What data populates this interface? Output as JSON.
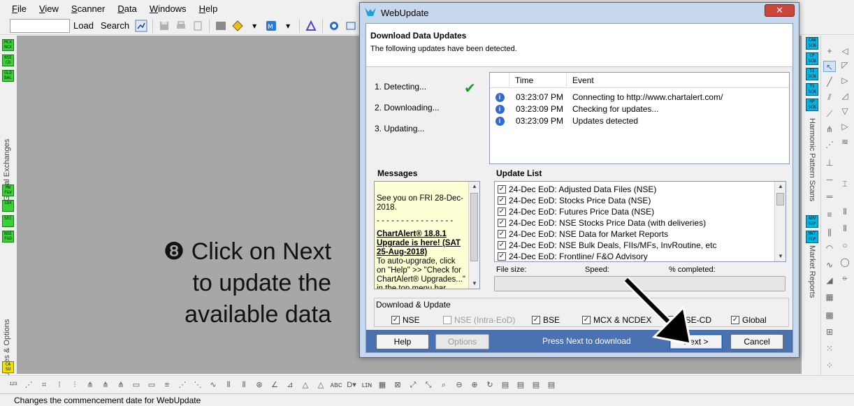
{
  "menubar": {
    "items": [
      "File",
      "View",
      "Scanner",
      "Data",
      "Windows",
      "Help"
    ]
  },
  "toolbar": {
    "search_value": "",
    "load_label": "Load",
    "search_label": "Search"
  },
  "leftbar": {
    "buttons_top": [
      "MCX NCX",
      "NSE CD",
      "GLO BAL"
    ],
    "section1_label": "Global Exchanges",
    "buttons_mid": [
      "MW F&V",
      "IDX",
      "SEC",
      "NSE F&O"
    ],
    "section2_label": "NSE Futures & Options",
    "button_bottom": "CA SU"
  },
  "rightbar": {
    "buttons_top": [
      "CAN SCN",
      "CP SCN",
      "TI SCN",
      "TS SCN",
      "HP SCN"
    ],
    "section1_label": "Harmonic Pattern Scans",
    "buttons_mid": [
      "ADV REP",
      "MKT REP"
    ],
    "section2_label": "Market Reports"
  },
  "annotation": {
    "line1": "❽ Click on Next",
    "line2": "to update the",
    "line3": "available data"
  },
  "dialog": {
    "title": "WebUpdate",
    "close_label": "✕",
    "header_title": "Download Data Updates",
    "header_subtitle": "The following updates have been detected.",
    "steps": [
      "1.  Detecting...",
      "2.  Downloading...",
      "3.  Updating..."
    ],
    "log": {
      "col_time": "Time",
      "col_event": "Event",
      "rows": [
        {
          "time": "03:23:07 PM",
          "event": "Connecting to http://www.chartalert.com/"
        },
        {
          "time": "03:23:09 PM",
          "event": "Checking for updates..."
        },
        {
          "time": "03:23:09 PM",
          "event": "Updates detected"
        }
      ]
    },
    "messages_label": "Messages",
    "messages": {
      "line1": "See you on FRI 28-Dec-2018.",
      "dashes": "- - - - - - - - - - - - - - - -",
      "bold": "ChartAlert® 18.8.1 Upgrade is here! (SAT 25-Aug-2018)",
      "body": "To auto-upgrade, click on \"Help\" >> \"Check for ChartAlert® Upgrades...\" in the top menu bar. Please"
    },
    "update_list_label": "Update List",
    "update_list": [
      "24-Dec EoD: Adjusted Data Files (NSE)",
      "24-Dec EoD: Stocks Price Data (NSE)",
      "24-Dec EoD: Futures Price Data (NSE)",
      "24-Dec EoD: NSE Stocks Price Data (with deliveries)",
      "24-Dec EoD: NSE Data for Market Reports",
      "24-Dec EoD: NSE Bulk Deals, FIIs/MFs, InvRoutine, etc",
      "24-Dec EoD: Frontline/ F&O Advisory"
    ],
    "file_size_label": "File size:",
    "speed_label": "Speed:",
    "percent_label": "% completed:",
    "progress": 0,
    "download_update_label": "Download & Update",
    "options": [
      {
        "label": "NSE",
        "checked": true,
        "enabled": true
      },
      {
        "label": "NSE (Intra-EoD)",
        "checked": false,
        "enabled": false
      },
      {
        "label": "BSE",
        "checked": true,
        "enabled": true
      },
      {
        "label": "MCX & NCDEX",
        "checked": true,
        "enabled": true
      },
      {
        "label": "NSE-CD",
        "checked": true,
        "enabled": true
      },
      {
        "label": "Global",
        "checked": true,
        "enabled": true
      }
    ],
    "help_label": "Help",
    "options_label": "Options",
    "footer_text": "Press Next to download",
    "next_label": "Next >",
    "cancel_label": "Cancel"
  },
  "statusbar": {
    "text": "Changes the commencement date for WebUpdate"
  },
  "colors": {
    "canvas": "#a7a7a7",
    "dialog_footer": "#4a72b0",
    "green_button": "#39d039",
    "blue_button": "#00b4e0"
  }
}
